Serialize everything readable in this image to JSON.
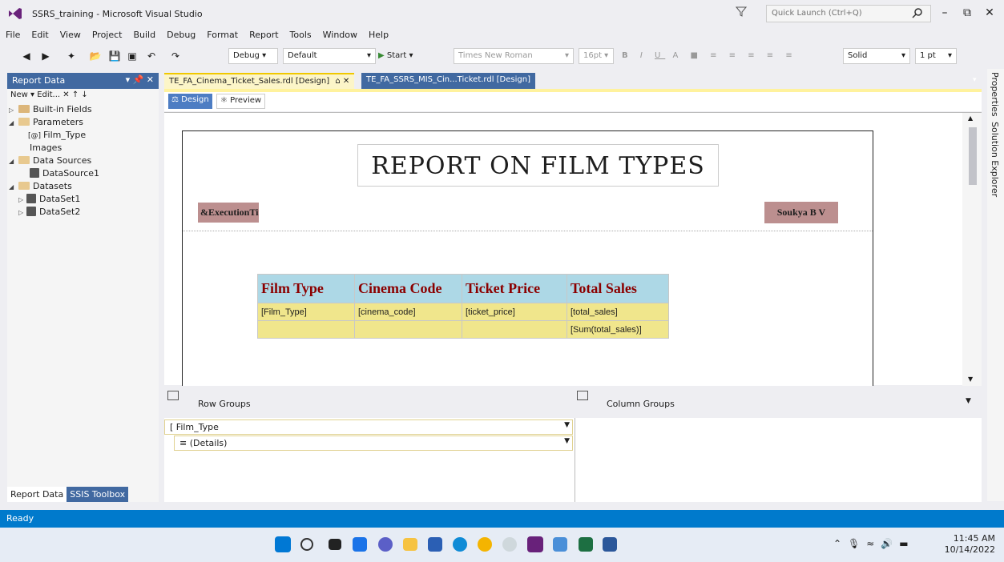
{
  "window": {
    "title": "SSRS_training - Microsoft Visual Studio",
    "quick_launch_placeholder": "Quick Launch (Ctrl+Q)"
  },
  "menu": [
    "File",
    "Edit",
    "View",
    "Project",
    "Build",
    "Debug",
    "Format",
    "Report",
    "Tools",
    "Window",
    "Help"
  ],
  "toolbar": {
    "config": "Debug",
    "platform": "Default",
    "start_label": "Start",
    "font": "Times New Roman",
    "font_size": "16pt",
    "border_style": "Solid",
    "border_width": "1 pt"
  },
  "report_data": {
    "title": "Report Data",
    "toolbar": "New ▾  Edit...  ✕  ↑  ↓",
    "items": [
      {
        "label": "Built-in Fields"
      },
      {
        "label": "Parameters"
      },
      {
        "label": "Film_Type"
      },
      {
        "label": "Images"
      },
      {
        "label": "Data Sources"
      },
      {
        "label": "DataSource1"
      },
      {
        "label": "Datasets"
      },
      {
        "label": "DataSet1"
      },
      {
        "label": "DataSet2"
      }
    ],
    "tabs": [
      "Report Data",
      "SSIS Toolbox"
    ]
  },
  "doc_tabs": [
    {
      "label": "TE_FA_Cinema_Ticket_Sales.rdl [Design]"
    },
    {
      "label": "TE_FA_SSRS_MIS_Cin...Ticket.rdl [Design]"
    }
  ],
  "view_tabs": {
    "design": "Design",
    "preview": "Preview"
  },
  "report": {
    "title": "REPORT ON FILM TYPES",
    "exec_time": "&ExecutionTime",
    "author": "Soukya B V",
    "headers": [
      "Film Type",
      "Cinema Code",
      "Ticket Price",
      "Total Sales"
    ],
    "detail_row": [
      "[Film_Type]",
      "[cinema_code]",
      "[ticket_price]",
      "[total_sales]"
    ],
    "total_row": [
      "",
      "",
      "",
      "[Sum(total_sales)]"
    ]
  },
  "groups": {
    "row_title": "Row Groups",
    "col_title": "Column Groups",
    "row_items": [
      "[ Film_Type",
      "≡ (Details)"
    ]
  },
  "right_bar": [
    "Properties",
    "Solution Explorer"
  ],
  "status": "Ready",
  "tray": {
    "time": "11:45 AM",
    "date": "10/14/2022"
  }
}
